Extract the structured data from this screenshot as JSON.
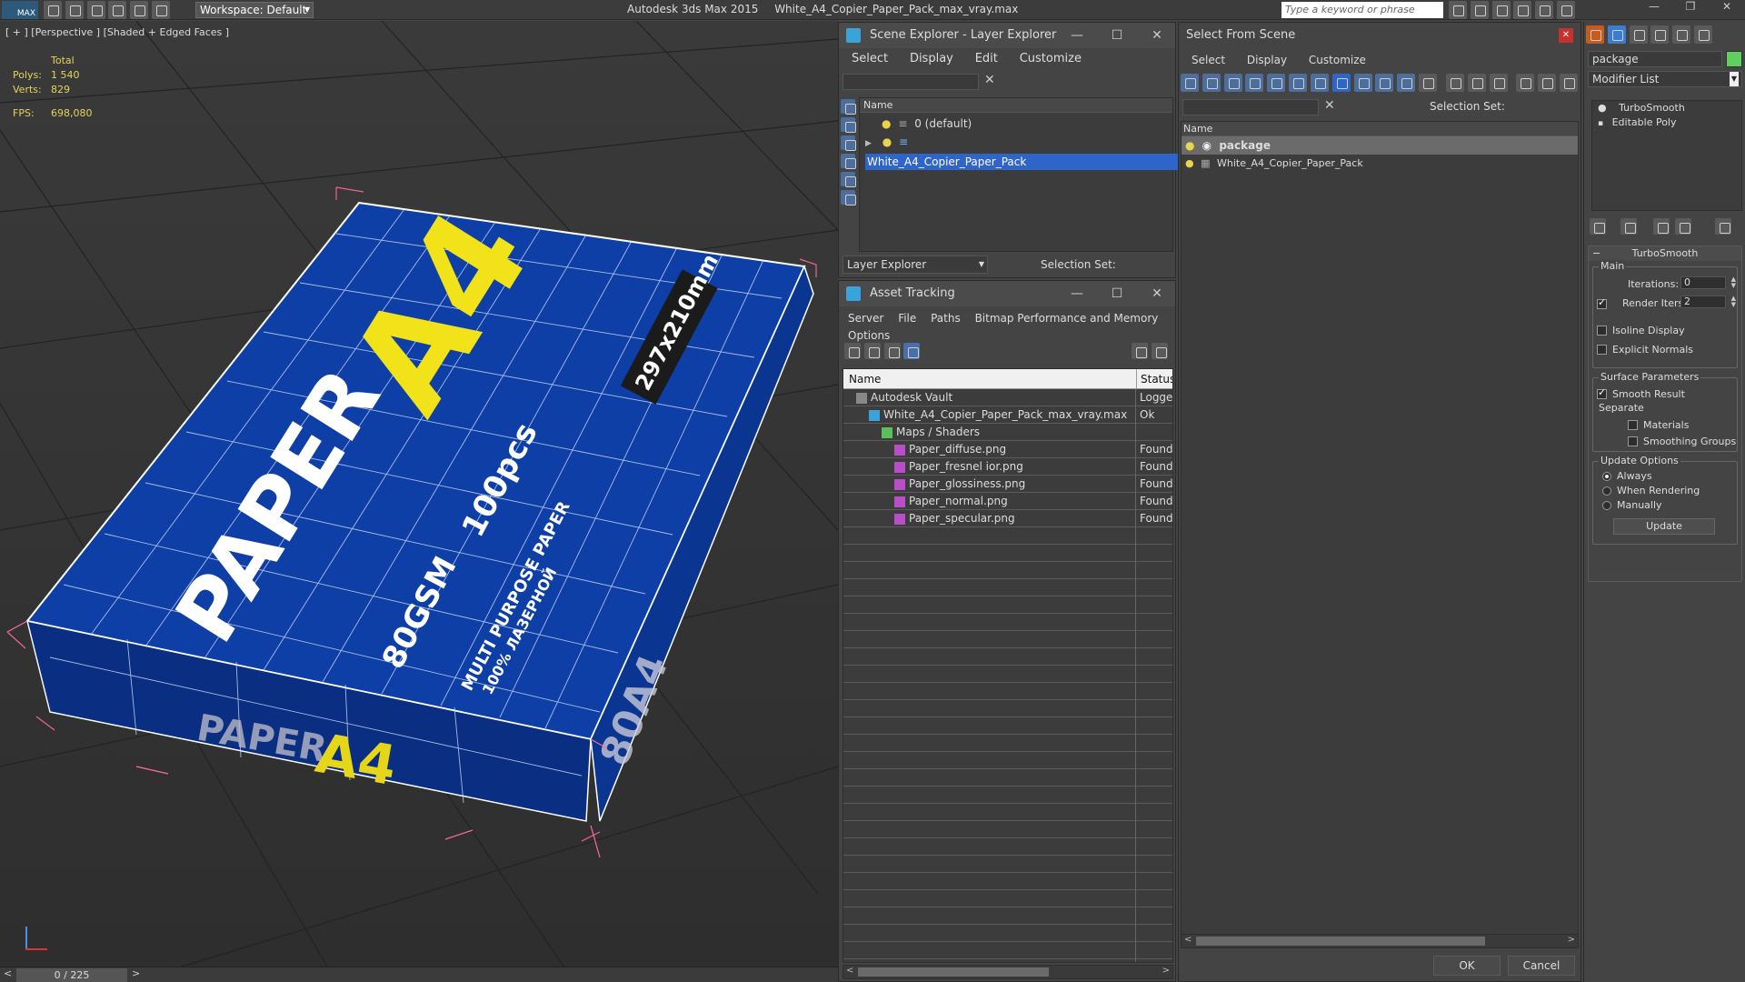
{
  "app": {
    "title": "Autodesk 3ds Max  2015",
    "file": "White_A4_Copier_Paper_Pack_max_vray.max",
    "workspace": "Workspace: Default",
    "search_placeholder": "Type a keyword or phrase"
  },
  "viewport": {
    "label": "[ + ] [Perspective ] [Shaded + Edged Faces ]",
    "stats_header": "Total",
    "polys_label": "Polys:",
    "polys_value": "1 540",
    "verts_label": "Verts:",
    "verts_value": "829",
    "fps_label": "FPS:",
    "fps_value": "698,080",
    "box_texts": {
      "paper": "PAPER",
      "a4": "A4",
      "size": "297x210mm",
      "pcs": "100pcs",
      "gsm": "80GSM",
      "multi": "MULTI PURPOSE PAPER",
      "multi2": "100% ЛАЗЕРНОЙ",
      "side_paper": "PAPER",
      "side_a4": "A4",
      "side_80": "80A4"
    },
    "timeline": "0 / 225"
  },
  "scene_explorer": {
    "title": "Scene Explorer - Layer Explorer",
    "menu": [
      "Select",
      "Display",
      "Edit",
      "Customize"
    ],
    "col_name": "Name",
    "rows": [
      "0 (default)",
      "White_A4_Copier_Paper_Pack"
    ],
    "footer_mode": "Layer Explorer",
    "selection_set": "Selection Set:"
  },
  "asset_tracking": {
    "title": "Asset Tracking",
    "menu": [
      "Server",
      "File",
      "Paths",
      "Bitmap Performance and Memory",
      "Options"
    ],
    "col_name": "Name",
    "col_status": "Status",
    "rows": [
      {
        "name": "Autodesk Vault",
        "status": "Logged",
        "indent": 0
      },
      {
        "name": "White_A4_Copier_Paper_Pack_max_vray.max",
        "status": "Ok",
        "indent": 1
      },
      {
        "name": "Maps / Shaders",
        "status": "",
        "indent": 2
      },
      {
        "name": "Paper_diffuse.png",
        "status": "Found",
        "indent": 3
      },
      {
        "name": "Paper_fresnel ior.png",
        "status": "Found",
        "indent": 3
      },
      {
        "name": "Paper_glossiness.png",
        "status": "Found",
        "indent": 3
      },
      {
        "name": "Paper_normal.png",
        "status": "Found",
        "indent": 3
      },
      {
        "name": "Paper_specular.png",
        "status": "Found",
        "indent": 3
      }
    ]
  },
  "select_from_scene": {
    "title": "Select From Scene",
    "menu": [
      "Select",
      "Display",
      "Customize"
    ],
    "selection_set": "Selection Set:",
    "col_name": "Name",
    "rows": [
      "package",
      "White_A4_Copier_Paper_Pack"
    ],
    "ok": "OK",
    "cancel": "Cancel"
  },
  "command_panel": {
    "object_name": "package",
    "modifier_list": "Modifier List",
    "stack": [
      "TurboSmooth",
      "Editable Poly"
    ],
    "rollout_title": "TurboSmooth",
    "main_label": "Main",
    "iterations_label": "Iterations:",
    "iterations_value": "0",
    "render_iters_label": "Render Iters:",
    "render_iters_value": "2",
    "isoline": "Isoline Display",
    "explicit_normals": "Explicit Normals",
    "surface_params": "Surface Parameters",
    "smooth_result": "Smooth Result",
    "separate": "Separate",
    "materials": "Materials",
    "smoothing_groups": "Smoothing Groups",
    "update_options": "Update Options",
    "always": "Always",
    "when_rendering": "When Rendering",
    "manually": "Manually",
    "update_btn": "Update"
  },
  "colors": {
    "box_blue": "#0d3fa6",
    "accent_yellow": "#f2e21a",
    "selection_blue": "#2f64c8",
    "stats_yellow": "#e6d35a"
  }
}
